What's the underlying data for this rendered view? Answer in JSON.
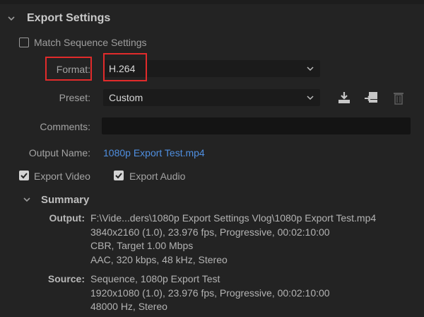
{
  "export_settings": {
    "title": "Export Settings",
    "match_sequence": {
      "label": "Match Sequence Settings",
      "checked": false
    },
    "format": {
      "label": "Format:",
      "value": "H.264"
    },
    "preset": {
      "label": "Preset:",
      "value": "Custom"
    },
    "comments": {
      "label": "Comments:",
      "value": ""
    },
    "output_name": {
      "label": "Output Name:",
      "value": "1080p Export Test.mp4"
    },
    "export_video": {
      "label": "Export Video",
      "checked": true
    },
    "export_audio": {
      "label": "Export Audio",
      "checked": true
    }
  },
  "summary": {
    "title": "Summary",
    "output": {
      "label": "Output:",
      "lines": [
        "F:\\Vide...ders\\1080p Export Settings Vlog\\1080p Export Test.mp4",
        "3840x2160 (1.0), 23.976 fps, Progressive, 00:02:10:00",
        "CBR, Target 1.00 Mbps",
        "AAC, 320 kbps, 48 kHz, Stereo"
      ]
    },
    "source": {
      "label": "Source:",
      "lines": [
        "Sequence, 1080p Export Test",
        "1920x1080 (1.0), 23.976 fps, Progressive, 00:02:10:00",
        "48000 Hz, Stereo"
      ]
    }
  },
  "icons": {
    "save_preset": "download-icon",
    "import_preset": "import-icon",
    "delete_preset": "trash-icon"
  },
  "colors": {
    "background": "#232323",
    "link": "#4f8fe0",
    "highlight": "#e12b2b"
  }
}
